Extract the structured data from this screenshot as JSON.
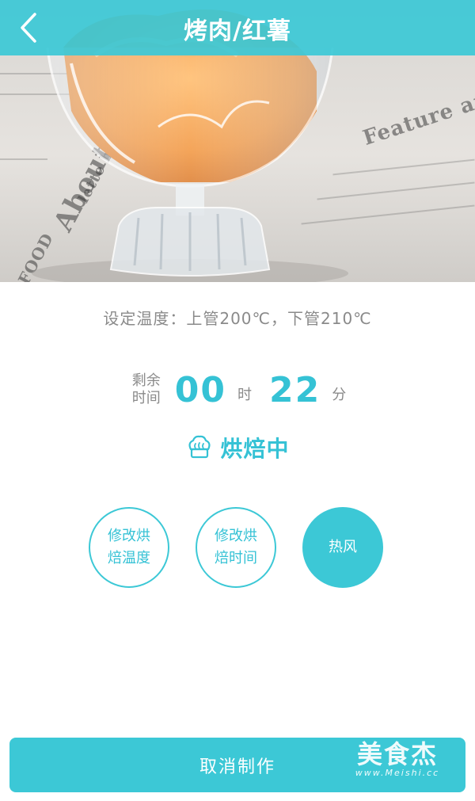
{
  "header": {
    "title": "烤肉/红薯",
    "back_icon": "chevron-left-icon"
  },
  "hero": {
    "background_words": [
      "About man",
      "lette bit",
      "FOOD",
      "Feature and"
    ]
  },
  "recipe": {
    "set_temperature": "设定温度：上管200℃，下管210℃"
  },
  "timer": {
    "label_line1": "剩余",
    "label_line2": "时间",
    "hours": "00",
    "hours_unit": "时",
    "minutes": "22",
    "minutes_unit": "分"
  },
  "status": {
    "icon": "chef-hat-steam-icon",
    "text": "烘焙中"
  },
  "actions": {
    "modify_temp_line1": "修改烘",
    "modify_temp_line2": "焙温度",
    "modify_time_line1": "修改烘",
    "modify_time_line2": "焙时间",
    "mode": "热风"
  },
  "footer": {
    "cancel_label": "取消制作"
  },
  "watermark": {
    "brand": "美食杰",
    "url": "www.Meishi.cc"
  },
  "colors": {
    "accent": "#3cc8d6",
    "text_gray": "#8a8a8a",
    "white": "#ffffff"
  }
}
